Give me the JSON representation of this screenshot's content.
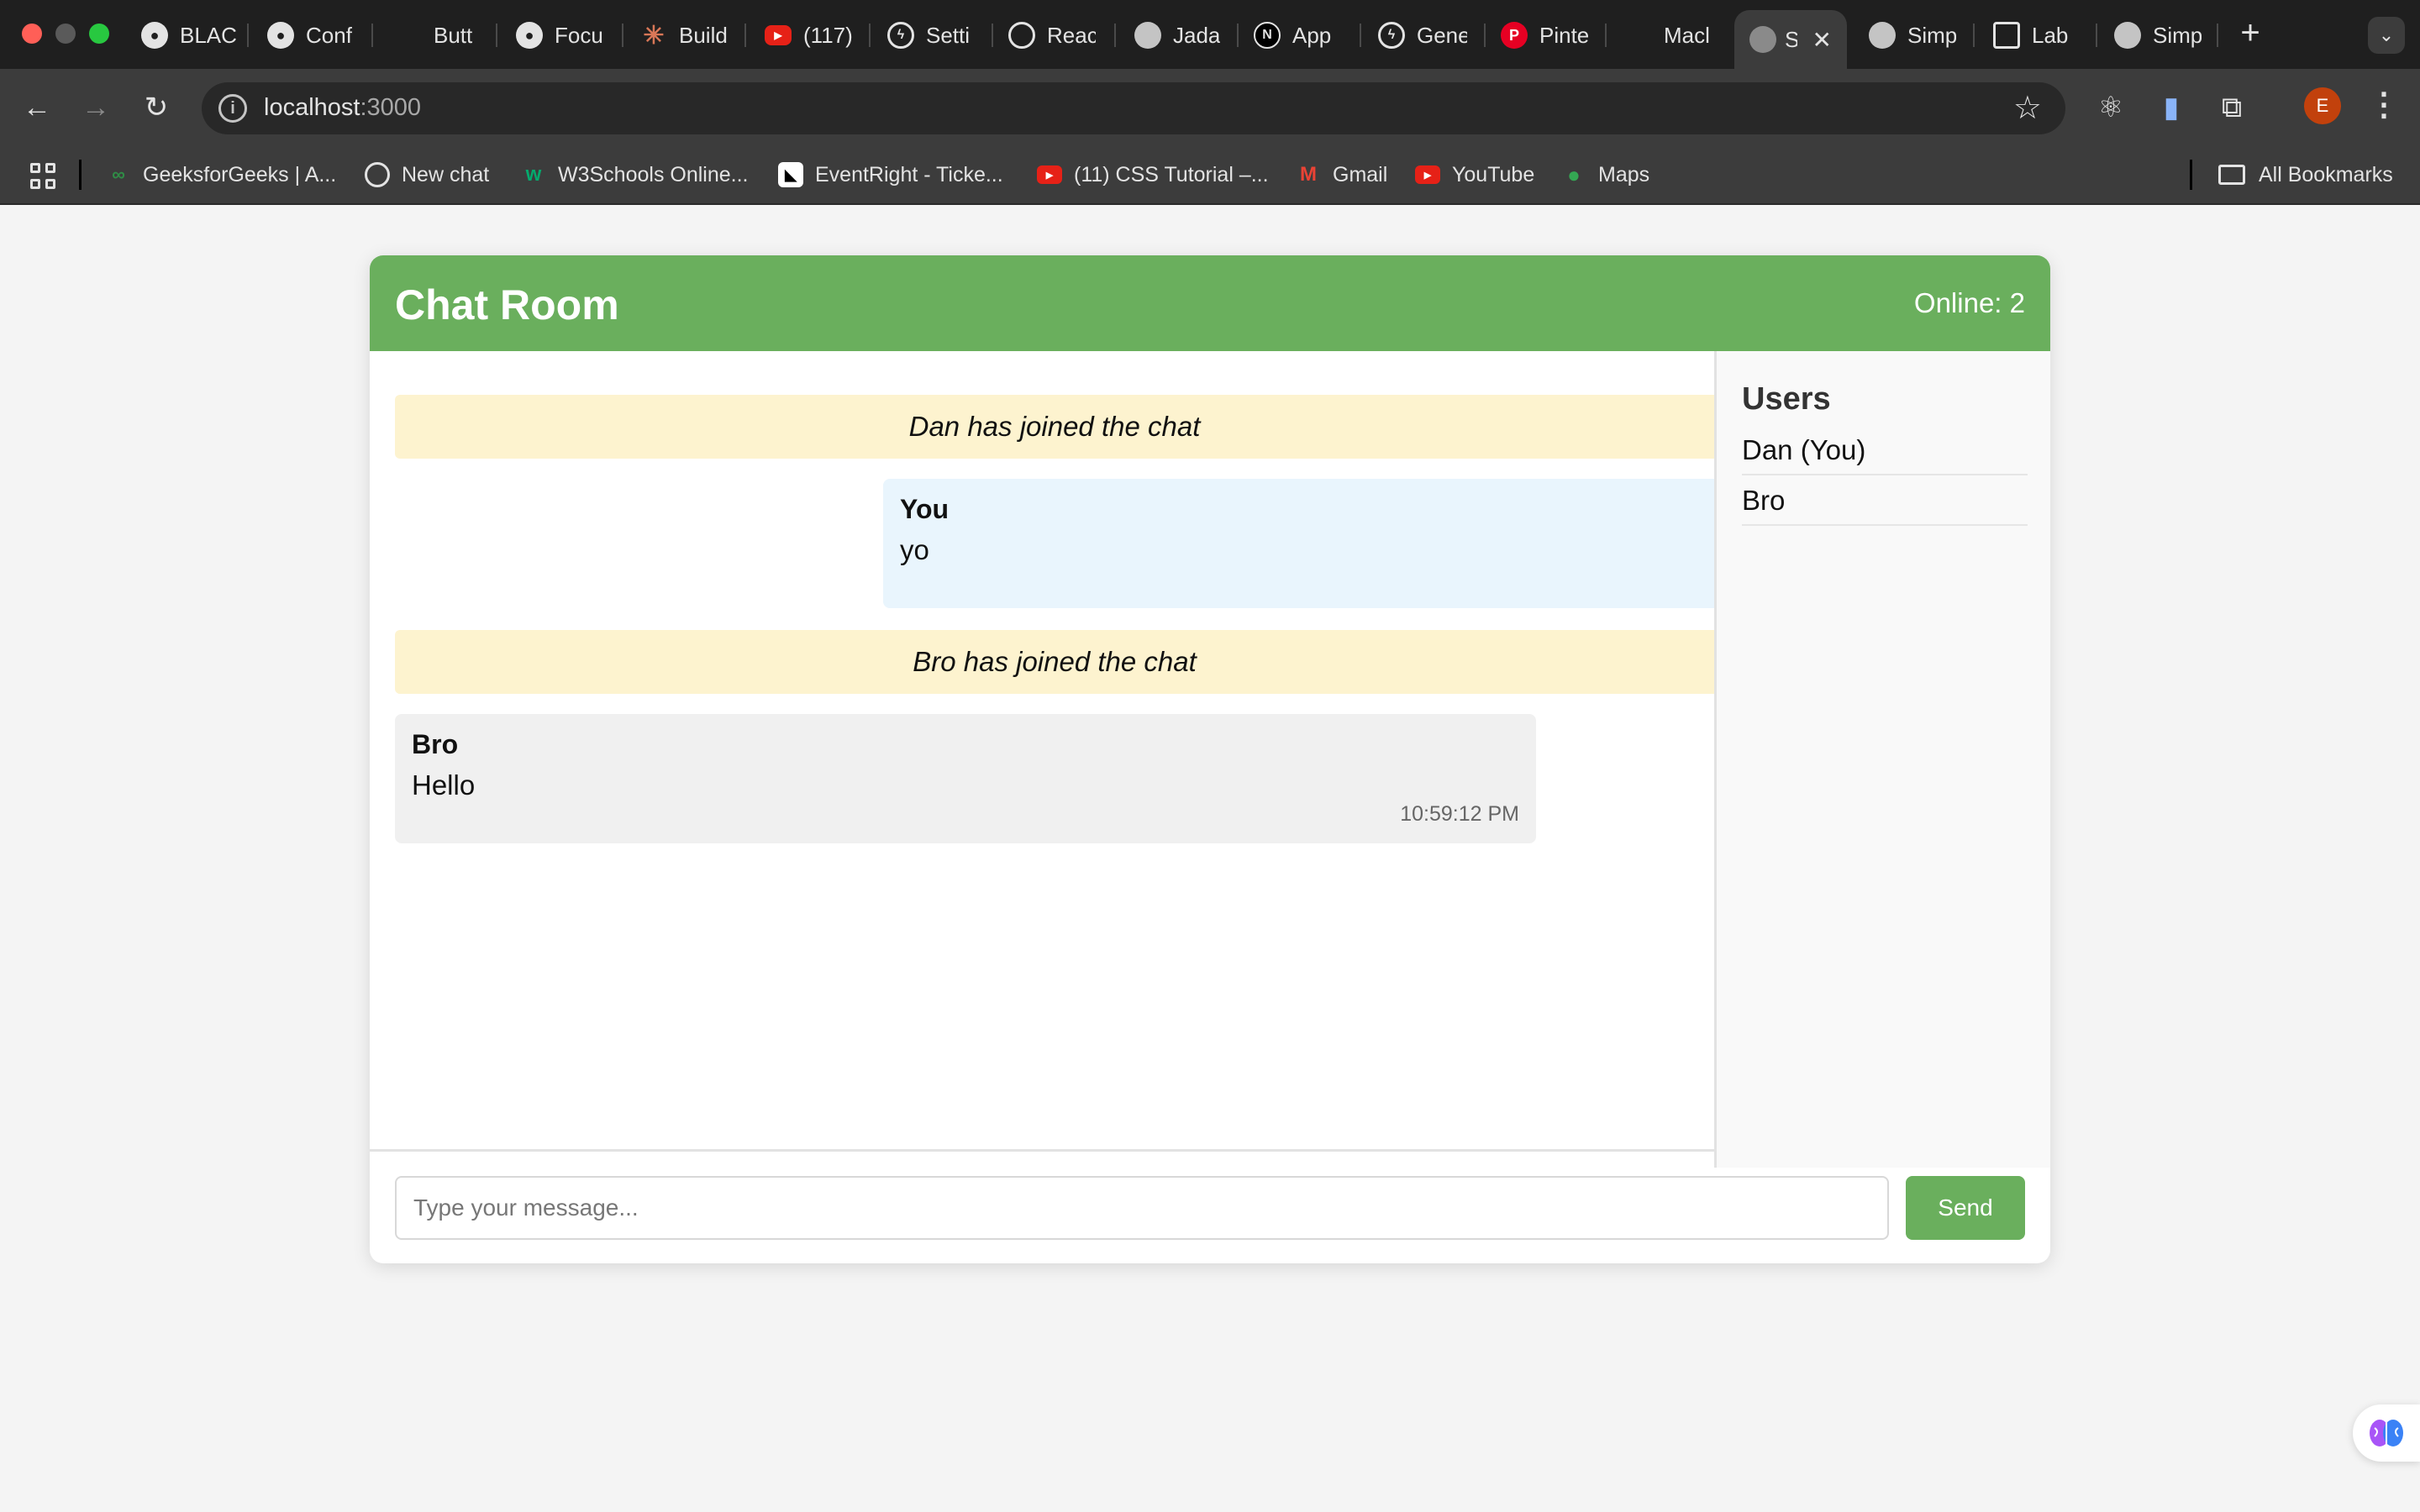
{
  "browser": {
    "tabs": [
      {
        "title": "BLAC",
        "icon": "github-icon"
      },
      {
        "title": "Conf",
        "icon": "github-icon"
      },
      {
        "title": "Butt",
        "icon": "blank-icon"
      },
      {
        "title": "Focu",
        "icon": "github-icon"
      },
      {
        "title": "Build",
        "icon": "claude-icon"
      },
      {
        "title": "(117)",
        "icon": "youtube-icon"
      },
      {
        "title": "Setti",
        "icon": "bolt-icon"
      },
      {
        "title": "Reac",
        "icon": "globe-icon"
      },
      {
        "title": "Jada",
        "icon": "globe-icon"
      },
      {
        "title": "App",
        "icon": "nextjs-icon"
      },
      {
        "title": "Gene",
        "icon": "bolt-icon"
      },
      {
        "title": "Pinte",
        "icon": "pinterest-icon"
      },
      {
        "title": "Macl",
        "icon": "blank-icon"
      },
      {
        "title": "S",
        "icon": "globe-icon",
        "active": true
      },
      {
        "title": "Simp",
        "icon": "globe-icon"
      },
      {
        "title": "Lab",
        "icon": "contact-icon"
      },
      {
        "title": "Simp",
        "icon": "globe-icon"
      }
    ],
    "url_host": "localhost",
    "url_port": ":3000",
    "profile_initial": "E",
    "bookmarks": [
      {
        "label": "GeeksforGeeks | A...",
        "icon": "gfg-icon"
      },
      {
        "label": "New chat",
        "icon": "openai-icon"
      },
      {
        "label": "W3Schools Online...",
        "icon": "w3schools-icon"
      },
      {
        "label": "EventRight - Ticke...",
        "icon": "eventright-icon"
      },
      {
        "label": "(11) CSS Tutorial –...",
        "icon": "youtube-icon"
      },
      {
        "label": "Gmail",
        "icon": "gmail-icon"
      },
      {
        "label": "YouTube",
        "icon": "youtube-icon"
      },
      {
        "label": "Maps",
        "icon": "maps-icon"
      }
    ],
    "all_bookmarks": "All Bookmarks"
  },
  "chat": {
    "title": "Chat Room",
    "online": "Online: 2",
    "messages": {
      "system_1": "Dan has joined the chat",
      "own": {
        "sender": "You",
        "text": "yo"
      },
      "system_2": "Bro has joined the chat",
      "other": {
        "sender": "Bro",
        "text": "Hello",
        "time": "10:59:12 PM"
      }
    },
    "users": {
      "title": "Users",
      "list": [
        "Dan (You)",
        "Bro"
      ]
    },
    "input": {
      "placeholder": "Type your message...",
      "value": ""
    },
    "send_label": "Send"
  },
  "colors": {
    "accent": "#6aaf5d",
    "system_bg": "#fdf3cf",
    "own_bg": "#e9f5fd",
    "other_bg": "#f0f0f0"
  }
}
